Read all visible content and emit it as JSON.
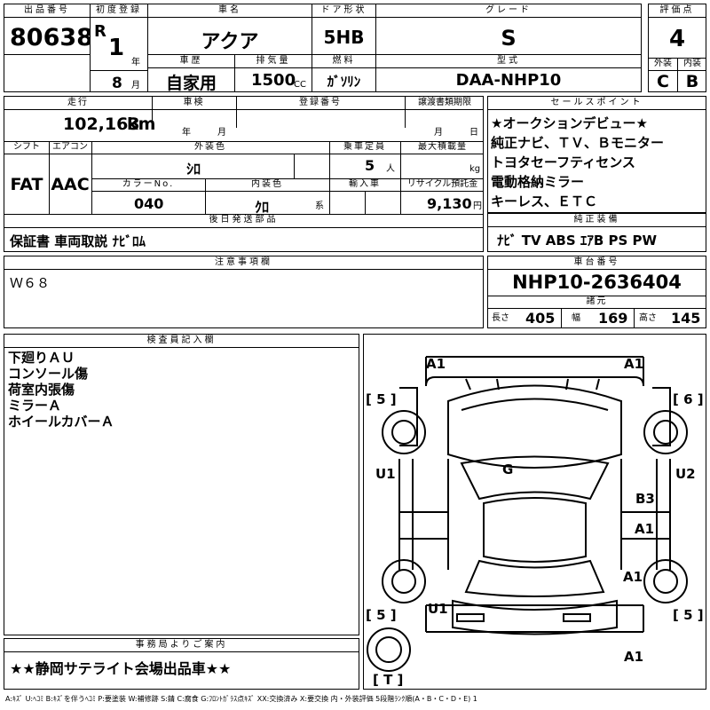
{
  "header": {
    "lot_number_label": "出品番号",
    "lot_number": "80638",
    "first_reg_label": "初度登録",
    "era_mark": "R",
    "reg_year": "1",
    "year_unit": "年",
    "reg_month": "8",
    "month_unit": "月",
    "car_name_label": "車名",
    "car_name": "アクア",
    "door_label": "ドア形状",
    "door_type": "5HB",
    "grade_label": "グレード",
    "grade": "S",
    "score_label": "評価点",
    "score": "4",
    "history_label": "車歴",
    "history": "自家用",
    "displacement_label": "排気量",
    "displacement": "1500",
    "displacement_unit": "CC",
    "fuel_label": "燃料",
    "fuel": "ｶﾞｿﾘﾝ",
    "model_label": "型式",
    "model": "DAA-NHP10",
    "exterior_label": "外装",
    "exterior_grade": "C",
    "interior_label": "内装",
    "interior_grade": "B"
  },
  "specs": {
    "mileage_label": "走行",
    "mileage": "102,163",
    "mileage_unit": "km",
    "inspection_label": "車検",
    "inspection_year_unit": "年",
    "inspection_month_unit": "月",
    "reg_no_label": "登録番号",
    "transfer_label": "譲渡書類期限",
    "transfer_month_unit": "月",
    "transfer_day_unit": "日",
    "shift_label": "シフト",
    "shift": "FAT",
    "ac_label": "エアコン",
    "ac": "AAC",
    "ext_color_label": "外装色",
    "ext_color": "ｼﾛ",
    "capacity_label": "乗車定員",
    "capacity": "5",
    "capacity_unit": "人",
    "max_load_label": "最大積載量",
    "max_load_unit": "kg",
    "color_no_label": "カラーNo.",
    "color_no": "040",
    "int_color_label": "内装色",
    "int_color": "ｸﾛ",
    "int_color_unit": "系",
    "import_label": "輸入車",
    "recycle_label": "リサイクル預託金",
    "recycle": "9,130",
    "recycle_unit": "円",
    "later_parts_label": "後日発送部品",
    "later_parts": "保証書 車両取説 ﾅﾋﾞﾛﾑ"
  },
  "sales_points": {
    "label": "セールスポイント",
    "items": [
      "★オークションデビュー★",
      "純正ナビ、ＴＶ、Ｂモニター",
      "トヨタセーフティセンス",
      "電動格納ミラー",
      "キーレス、ＥＴＣ"
    ]
  },
  "equipment": {
    "label": "純正装備",
    "value": "ﾅﾋﾞ  TV  ABS  ｴｱB  PS  PW"
  },
  "notes": {
    "label": "注意事項欄",
    "value": "Ｗ６８"
  },
  "chassis": {
    "label": "車台番号",
    "value": "NHP10-2636404",
    "dims_label": "諸元",
    "length_label": "長さ",
    "length": "405",
    "width_label": "幅",
    "width": "169",
    "height_label": "高さ",
    "height": "145"
  },
  "inspector": {
    "label": "検査員記入欄",
    "items": [
      "下廻りＡＵ",
      "コンソール傷",
      "荷室内張傷",
      "ミラーＡ",
      "ホイールカバーＡ"
    ]
  },
  "office": {
    "label": "事務局よりご案内",
    "value": "★★静岡サテライト会場出品車★★"
  },
  "legend": "A:ｷｽﾞ U:ﾍｺﾐ B:ｷｽﾞを伴うﾍｺﾐ P:要塗装 W:補修跡 S:錆 C:腐食 G:ﾌﾛﾝﾄｶﾞﾗｽ点ｷｽﾞ XX:交換済み X:要交換 内・外装評価 5段階ﾗﾝｸ順(A・B・C・D・E) 1",
  "diagram": {
    "marks": {
      "front_left": "A1",
      "front_right": "A1",
      "tire_fl": "[ 5 ]",
      "tire_fr": "[ 6 ]",
      "left_side": "U1",
      "right_side": "U2",
      "glass": "G",
      "right_rear_door": "B3",
      "right_quarter": "A1",
      "right_rear": "A1",
      "tire_rl": "[ 5 ]",
      "tire_rr": "[ 5 ]",
      "left_rear": "U1",
      "rear_bumper": "A1",
      "trunk": "[ T ]"
    }
  }
}
